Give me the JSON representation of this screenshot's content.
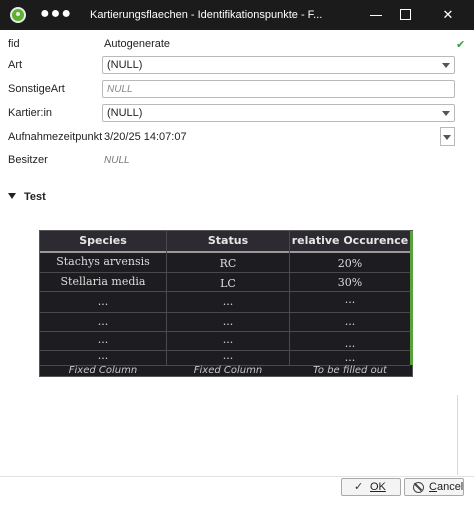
{
  "window": {
    "title": "Kartierungsflaechen - Identifikationspunkte - F...",
    "menu_glyph": "●●●",
    "minimize_label": "",
    "maximize_label": "",
    "close_glyph": "✕"
  },
  "form": {
    "fid": {
      "label": "fid",
      "value": "Autogenerate",
      "status_glyph": "✔"
    },
    "art": {
      "label": "Art",
      "value": "(NULL)"
    },
    "sonstigeart": {
      "label": "SonstigeArt",
      "placeholder": "NULL"
    },
    "kartierin": {
      "label": "Kartier:in",
      "value": "(NULL)"
    },
    "aufnahmezeitpunkt": {
      "label": "Aufnahmezeitpunkt",
      "value": "3/20/25 14:07:07"
    },
    "besitzer": {
      "label": "Besitzer",
      "value": "NULL"
    }
  },
  "section": {
    "title": "Test"
  },
  "table": {
    "headers": [
      "Species",
      "Status",
      "relative Occurence"
    ],
    "rows": [
      [
        "Stachys arvensis",
        "RC",
        "20%"
      ],
      [
        "Stellaria media",
        "LC",
        "30%"
      ],
      [
        "...",
        "...",
        "..."
      ],
      [
        "...",
        "...",
        "..."
      ],
      [
        "...",
        "...",
        "..."
      ],
      [
        "...",
        "...",
        "..."
      ]
    ],
    "footers": [
      "Fixed Column",
      "Fixed Column",
      "To be filled out"
    ]
  },
  "buttons": {
    "ok_glyph": "✓",
    "ok_label": "OK",
    "cancel_prefix": "",
    "cancel_underlined": "C",
    "cancel_rest": "ancel"
  },
  "colors": {
    "titlebar": "#1b1b1b",
    "table_background": "#1d1c21",
    "table_accent": "#5aa03c",
    "valid_check": "#3a9d3a"
  }
}
